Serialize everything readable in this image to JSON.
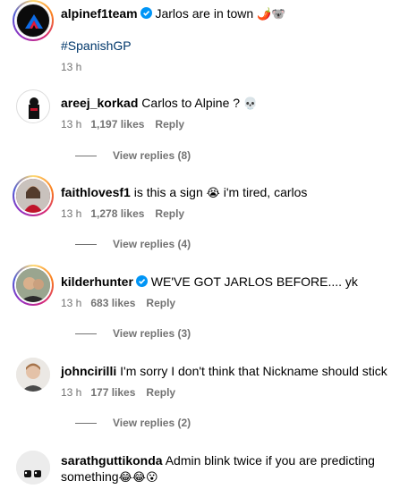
{
  "post": {
    "username": "alpinef1team",
    "caption": "Jarlos are in town",
    "caption_emojis": "🌶️🐨",
    "hashtag": "#SpanishGP",
    "time": "13 h",
    "accent": "#0095f6"
  },
  "comments": [
    {
      "username": "areej_korkad",
      "text": "Carlos to Alpine ?",
      "emoji": "💀",
      "time": "13 h",
      "likes": "1,197 likes",
      "reply": "Reply",
      "view_replies": "View replies (8)"
    },
    {
      "username": "faithlovesf1",
      "text": "is this a sign",
      "emoji": "😭",
      "text2": "i'm tired, carlos",
      "time": "13 h",
      "likes": "1,278 likes",
      "reply": "Reply",
      "view_replies": "View replies (4)"
    },
    {
      "username": "kilderhunter",
      "text": "WE'VE GOT JARLOS BEFORE.... yk",
      "time": "13 h",
      "likes": "683 likes",
      "reply": "Reply",
      "view_replies": "View replies (3)"
    },
    {
      "username": "johncirilli",
      "text": "I'm sorry I don't think that Nickname should stick",
      "time": "13 h",
      "likes": "177 likes",
      "reply": "Reply",
      "view_replies": "View replies (2)"
    },
    {
      "username": "sarathguttikonda",
      "text": "Admin blink twice if you are predicting",
      "text_line2": "something",
      "emoji": "😂😂😮"
    }
  ]
}
